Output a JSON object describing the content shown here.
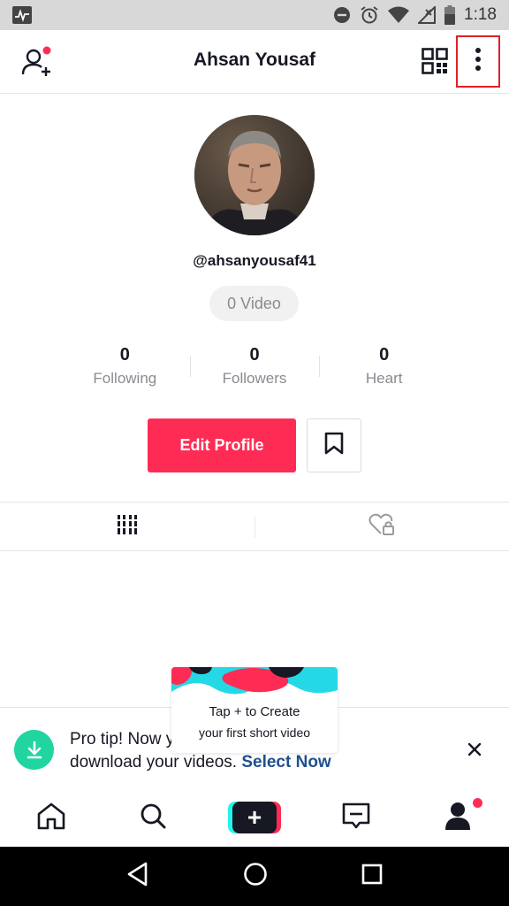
{
  "status_bar": {
    "time": "1:18",
    "icons": [
      "activity-icon",
      "do-not-disturb-icon",
      "alarm-icon",
      "wifi-icon",
      "no-signal-icon",
      "battery-icon"
    ]
  },
  "header": {
    "title": "Ahsan Yousaf",
    "left_icon": "add-friend-icon",
    "right_icons": [
      "qr-code-icon",
      "more-vertical-icon"
    ],
    "highlight_color": "#e0202a"
  },
  "profile": {
    "username": "@ahsanyousaf41",
    "video_count": "0 Video",
    "stats": [
      {
        "value": "0",
        "label": "Following"
      },
      {
        "value": "0",
        "label": "Followers"
      },
      {
        "value": "0",
        "label": "Heart"
      }
    ],
    "edit_profile_label": "Edit Profile",
    "accent_color": "#fe2c55"
  },
  "tabs": [
    {
      "icon": "video-grid-icon",
      "active": true
    },
    {
      "icon": "liked-private-icon",
      "active": false
    }
  ],
  "create_tooltip": {
    "line1": "Tap + to Create",
    "line2": "your first short video"
  },
  "pro_tip": {
    "text_before": "Pro tip! Now you can download your videos. ",
    "line1": "Pro tip! Now you can",
    "line2_prefix": "download your videos. ",
    "link": "Select Now"
  },
  "bottom_nav": [
    "home-icon",
    "discover-icon",
    "create-icon",
    "inbox-icon",
    "me-icon"
  ],
  "system_nav": [
    "back-icon",
    "home-circle-icon",
    "recents-icon"
  ]
}
